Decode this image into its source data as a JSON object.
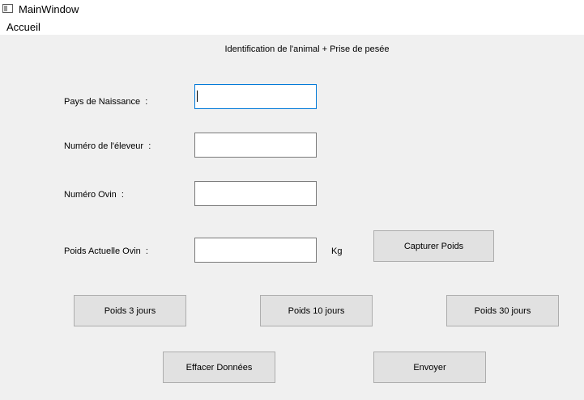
{
  "window": {
    "title": "MainWindow",
    "icon": "app-window-icon"
  },
  "menu": {
    "items": [
      "Accueil"
    ]
  },
  "form": {
    "heading": "Identification de l'animal + Prise de pesée",
    "fields": [
      {
        "label": "Pays de Naissance  :",
        "value": ""
      },
      {
        "label": "Numéro de l'éleveur  :",
        "value": ""
      },
      {
        "label": "Numéro Ovin  :",
        "value": ""
      },
      {
        "label": "Poids Actuelle Ovin  :",
        "value": ""
      }
    ],
    "weight_unit": "Kg"
  },
  "buttons": {
    "capture": "Capturer Poids",
    "poids_3": "Poids 3 jours",
    "poids_10": "Poids 10 jours",
    "poids_30": "Poids 30 jours",
    "clear": "Effacer Données",
    "send": "Envoyer"
  },
  "colors": {
    "focus_border": "#0078d7",
    "button_bg": "#e1e1e1",
    "window_bg": "#f0f0f0"
  }
}
